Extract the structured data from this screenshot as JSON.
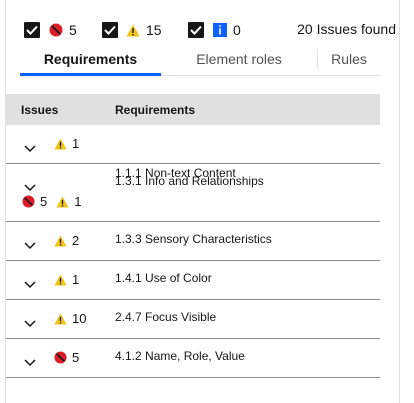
{
  "filters": [
    {
      "icon": "violation-icon",
      "count": "5"
    },
    {
      "icon": "warning-icon",
      "count": "15"
    },
    {
      "icon": "info-icon",
      "count": "0"
    }
  ],
  "issues_found": "20 Issues found",
  "tabs": [
    {
      "label": "Requirements",
      "active": true
    },
    {
      "label": "Element roles",
      "active": false
    },
    {
      "label": "Rules",
      "active": false
    }
  ],
  "table": {
    "headers": {
      "issues": "Issues",
      "requirements": "Requirements"
    },
    "rows": [
      {
        "requirement": "1.1.1 Non-text Content",
        "violations": "",
        "warnings": "1"
      },
      {
        "requirement": "1.3.1 Info and Relationships",
        "violations": "5",
        "warnings": "1"
      },
      {
        "requirement": "1.3.3 Sensory Characteristics",
        "violations": "",
        "warnings": "2"
      },
      {
        "requirement": "1.4.1 Use of Color",
        "violations": "",
        "warnings": "1"
      },
      {
        "requirement": "2.4.7 Focus Visible",
        "violations": "",
        "warnings": "10"
      },
      {
        "requirement": "4.1.2 Name, Role, Value",
        "violations": "5",
        "warnings": ""
      }
    ]
  },
  "colors": {
    "violation": "#da1e28",
    "warning": "#f1c21b",
    "info": "#0f62fe",
    "tab_active": "#0f62fe"
  }
}
